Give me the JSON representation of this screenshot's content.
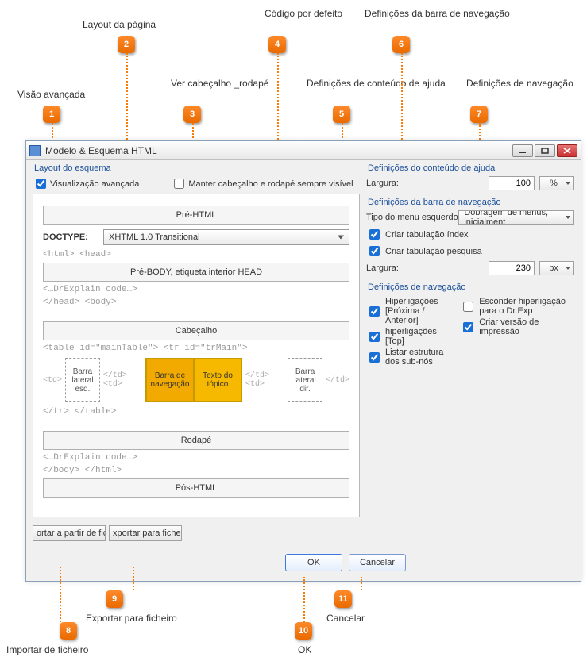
{
  "callouts": {
    "c1": {
      "num": "1",
      "label": "Visão avançada"
    },
    "c2": {
      "num": "2",
      "label": "Layout da página"
    },
    "c3": {
      "num": "3",
      "label": "Ver cabeçalho _rodapé"
    },
    "c4": {
      "num": "4",
      "label": "Código por defeito"
    },
    "c5": {
      "num": "5",
      "label": "Definições de conteúdo de ajuda"
    },
    "c6": {
      "num": "6",
      "label": "Definições da barra de navegação"
    },
    "c7": {
      "num": "7",
      "label": "Definições de navegação"
    },
    "c8": {
      "num": "8",
      "label": "Importar de ficheiro"
    },
    "c9": {
      "num": "9",
      "label": "Exportar para ficheiro"
    },
    "c10": {
      "num": "10",
      "label": "OK"
    },
    "c11": {
      "num": "11",
      "label": "Cancelar"
    }
  },
  "dialog": {
    "title": "Modelo & Esquema HTML",
    "left": {
      "section": "Layout do esquema",
      "adv_view": "Visualização avançada",
      "keep_hf": "Manter cabeçalho e rodapé sempre visível",
      "pre_html": "Pré-HTML",
      "doctype_label": "DOCTYPE:",
      "doctype_value": "XHTML 1.0 Transitional",
      "code_html_head": "<html> <head>",
      "pre_body": "Pré-BODY, etiqueta interior HEAD",
      "code_drex1": "<…DrExplain code…>",
      "code_head_body": "</head> <body>",
      "header": "Cabeçalho",
      "code_table": "<table id=\"mainTable\"> <tr id=\"trMain\">",
      "sidebar_left": "Barra lateral esq.",
      "nav": "Barra de navegação",
      "topic": "Texto do tópico",
      "sidebar_right": "Barra lateral dir.",
      "code_table_close": "</tr> </table>",
      "footer": "Rodapé",
      "code_drex2": "<…DrExplain code…>",
      "code_body_html": "</body> </html>",
      "post_html": "Pós-HTML",
      "import_btn": "ortar a partir de fich",
      "export_btn": "xportar para ficheir"
    },
    "right": {
      "help_section": "Definições do conteúdo de ajuda",
      "width_label": "Largura:",
      "help_width": "100",
      "help_unit": "%",
      "nav_section": "Definições da barra de navegação",
      "left_menu_type": "Tipo do menu esquerdo",
      "left_menu_value": "Dobragem de menus, inicialment",
      "create_index": "Criar tabulação índex",
      "create_search": "Criar tabulação pesquisa",
      "nav_width": "230",
      "nav_unit": "px",
      "navdef_section": "Definições de navegação",
      "prev_next": "Hiperligações [Próxima / Anterior]",
      "top_links": "hiperligações [Top]",
      "list_subs": "Listar  estrutura dos sub-nós",
      "hide_drexp": "Esconder hiperligação para o Dr.Exp",
      "print_version": "Criar versão de impressão"
    },
    "ok": "OK",
    "cancel": "Cancelar"
  }
}
